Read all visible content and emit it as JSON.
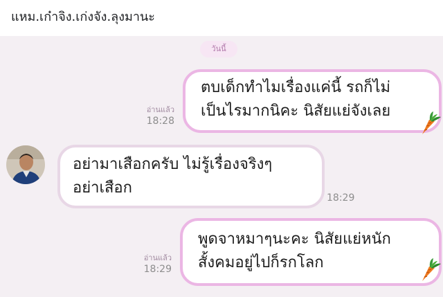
{
  "header": {
    "title": "แหม.เก๋าจิง.เก่งจัง.ลุงมานะ"
  },
  "chat": {
    "date_label": "วันนี้",
    "messages": [
      {
        "direction": "outgoing",
        "lines": [
          "ตบเด็กทำไมเรื่องแค่นี้ รถก็ไม่",
          "เป็นไรมากนิคะ นิสัยแย่จังเลย"
        ],
        "status": "อ่านแล้ว",
        "time": "18:28",
        "sticker_icon": "carrot-icon"
      },
      {
        "direction": "incoming",
        "lines": [
          "อย่ามาเสือกครับ ไม่รู้เรื่องจริงๆ",
          "อย่าเสือก"
        ],
        "time": "18:29",
        "avatar_icon": "avatar-photo"
      },
      {
        "direction": "outgoing",
        "lines": [
          "พูดจาหมาๆนะคะ นิสัยแย่หนัก",
          "สั้งคมอยู่ไปก็รกโลก"
        ],
        "status": "อ่านแล้ว",
        "time": "18:29",
        "sticker_icon": "carrot-icon"
      }
    ]
  },
  "colors": {
    "chat_background": "#f4eff3",
    "outgoing_border": "#ebb6e4",
    "incoming_border": "#e8d7e6",
    "date_pill_text": "#b27aab"
  }
}
